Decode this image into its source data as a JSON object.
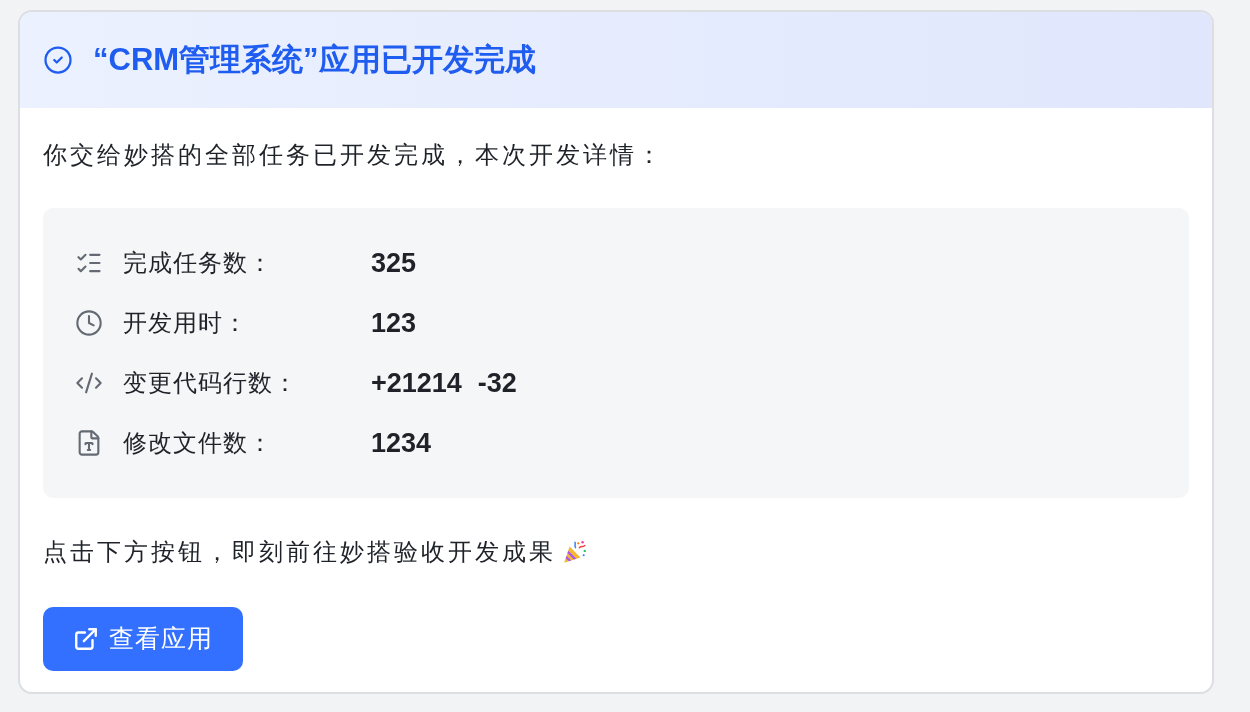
{
  "card": {
    "title": "“CRM管理系统”应用已开发完成"
  },
  "intro": "你交给妙搭的全部任务已开发完成，本次开发详情：",
  "details": [
    {
      "kind": "tasks",
      "label": "完成任务数：",
      "values": [
        "325"
      ]
    },
    {
      "kind": "time",
      "label": "开发用时：",
      "values": [
        "123"
      ]
    },
    {
      "kind": "code",
      "label": "变更代码行数：",
      "values": [
        "+21214",
        "-32"
      ]
    },
    {
      "kind": "files",
      "label": "修改文件数：",
      "values": [
        "1234"
      ]
    }
  ],
  "prompt": "点击下方按钮，即刻前往妙搭验收开发成果",
  "button": {
    "label": "查看应用"
  }
}
